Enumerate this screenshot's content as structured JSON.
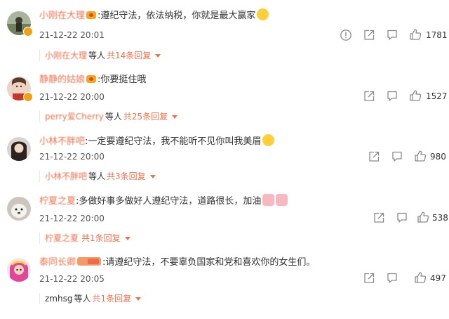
{
  "comments": [
    {
      "username": "小刚在大理",
      "text": "遵纪守法，依法纳税，你就是最大赢家",
      "time": "21-12-22 20:01",
      "reply_user": "小刚在大理",
      "reply_who": "等人",
      "reply_count": "共14条回复",
      "likes": "1781",
      "avatar_color": "#7a8a6a"
    },
    {
      "username": "静静的姑娘",
      "text": "你要挺住哦",
      "time": "21-12-22 20:00",
      "reply_user": "perry爱Cherry",
      "reply_who": "等人",
      "reply_count": "共25条回复",
      "likes": "1527",
      "avatar_color": "#c98a6a"
    },
    {
      "username": "小林不胖吧",
      "text": "一定要遵纪守法，我不能听不见你叫我美眉",
      "time": "21-12-22 20:00",
      "reply_user": "小林不胖吧",
      "reply_who": "等人",
      "reply_count": "共3条回复",
      "likes": "980",
      "avatar_color": "#5a4a42"
    },
    {
      "username": "柠夏之夏",
      "text": "多做好事多做好人遵纪守法，道路很长，加油",
      "time": "21-12-22 20:00",
      "reply_user": "柠夏之夏",
      "reply_who": "",
      "reply_count": "共1条回复",
      "likes": "538",
      "avatar_color": "#b9b0a6"
    },
    {
      "username": "泰同长卿",
      "text": "请遵纪守法，不要辜负国家和党和喜欢你的女生们。",
      "time": "21-12-22 20:05",
      "reply_user": "zmhsg",
      "reply_who": "等人",
      "reply_count": "共1条回复",
      "likes": "497",
      "avatar_color": "#e05aa0"
    }
  ],
  "icons": {
    "report": "report-icon",
    "share": "share-icon",
    "comment": "comment-icon",
    "like": "thumbs-up-icon"
  },
  "colors": {
    "username": "#eb7350",
    "badge": "#f0a017",
    "icon": "#8a8a8a"
  }
}
